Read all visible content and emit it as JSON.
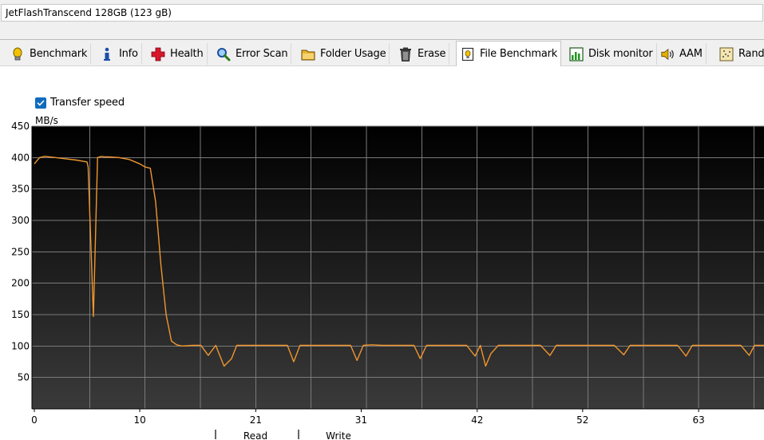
{
  "device": {
    "label": "JetFlashTranscend 128GB (123 gB)"
  },
  "tabs": [
    {
      "label": "Benchmark",
      "icon": "lightbulb-icon"
    },
    {
      "label": "Info",
      "icon": "info-icon"
    },
    {
      "label": "Health",
      "icon": "red-cross-icon"
    },
    {
      "label": "Error Scan",
      "icon": "magnifier-icon"
    },
    {
      "label": "Folder Usage",
      "icon": "folder-icon"
    },
    {
      "label": "Erase",
      "icon": "trash-icon"
    },
    {
      "label": "File Benchmark",
      "icon": "file-benchmark-icon",
      "active": true
    },
    {
      "label": "Disk monitor",
      "icon": "disk-monitor-icon"
    },
    {
      "label": "AAM",
      "icon": "speaker-icon"
    },
    {
      "label": "Rand",
      "icon": "random-access-icon"
    }
  ],
  "options": {
    "transfer_speed_label": "Transfer speed",
    "transfer_speed_checked": true
  },
  "chart_data": {
    "type": "line",
    "ylabel": "MB/s",
    "ylim": [
      0,
      450
    ],
    "yticks": [
      50,
      100,
      150,
      200,
      250,
      300,
      350,
      400,
      450
    ],
    "xlim": [
      0,
      69.2
    ],
    "xticks": [
      0,
      10,
      21,
      31,
      42,
      52,
      63
    ],
    "grid": true,
    "background": "#000000",
    "line_color": "#f0962e",
    "legend": [
      "Read",
      "Write"
    ],
    "series": [
      {
        "x": [
          0,
          0.5,
          1,
          2,
          3,
          4,
          5,
          5.1,
          5.6,
          6.0,
          6.4,
          6.6,
          7,
          8,
          9,
          10,
          10.5,
          11,
          11.5,
          12,
          12.5,
          13,
          13.5,
          14,
          15,
          15.8,
          16.5,
          17.2,
          18,
          18.7,
          19.2,
          19.7,
          20.5,
          21,
          22,
          23,
          24,
          24.6,
          25.2,
          26,
          27,
          28,
          29,
          30,
          30.6,
          31.2,
          32,
          33,
          34,
          35,
          36,
          36.6,
          37.2,
          38,
          39,
          40,
          41,
          41.8,
          42.3,
          42.8,
          43.3,
          44,
          45,
          46,
          47,
          48,
          48.9,
          49.5,
          50,
          51,
          52,
          53,
          54,
          55,
          55.9,
          56.5,
          57,
          58,
          59,
          60,
          61,
          61.8,
          62.4,
          63,
          64,
          65,
          66,
          67,
          67.8,
          68.3,
          69,
          69.2
        ],
        "values": [
          390,
          400,
          402,
          400,
          398,
          396,
          393,
          385,
          147,
          400,
          402,
          401,
          401,
          400,
          397,
          390,
          385,
          383,
          330,
          230,
          150,
          108,
          102,
          100,
          101,
          101,
          85,
          101,
          68,
          80,
          101,
          101,
          101,
          101,
          101,
          101,
          101,
          75,
          101,
          101,
          101,
          101,
          101,
          101,
          77,
          101,
          102,
          101,
          101,
          101,
          101,
          80,
          101,
          101,
          101,
          101,
          101,
          84,
          101,
          68,
          88,
          101,
          101,
          101,
          101,
          101,
          85,
          101,
          101,
          101,
          101,
          101,
          101,
          101,
          86,
          101,
          101,
          101,
          101,
          101,
          101,
          84,
          101,
          101,
          101,
          101,
          101,
          101,
          85,
          101,
          101,
          101
        ]
      }
    ]
  }
}
